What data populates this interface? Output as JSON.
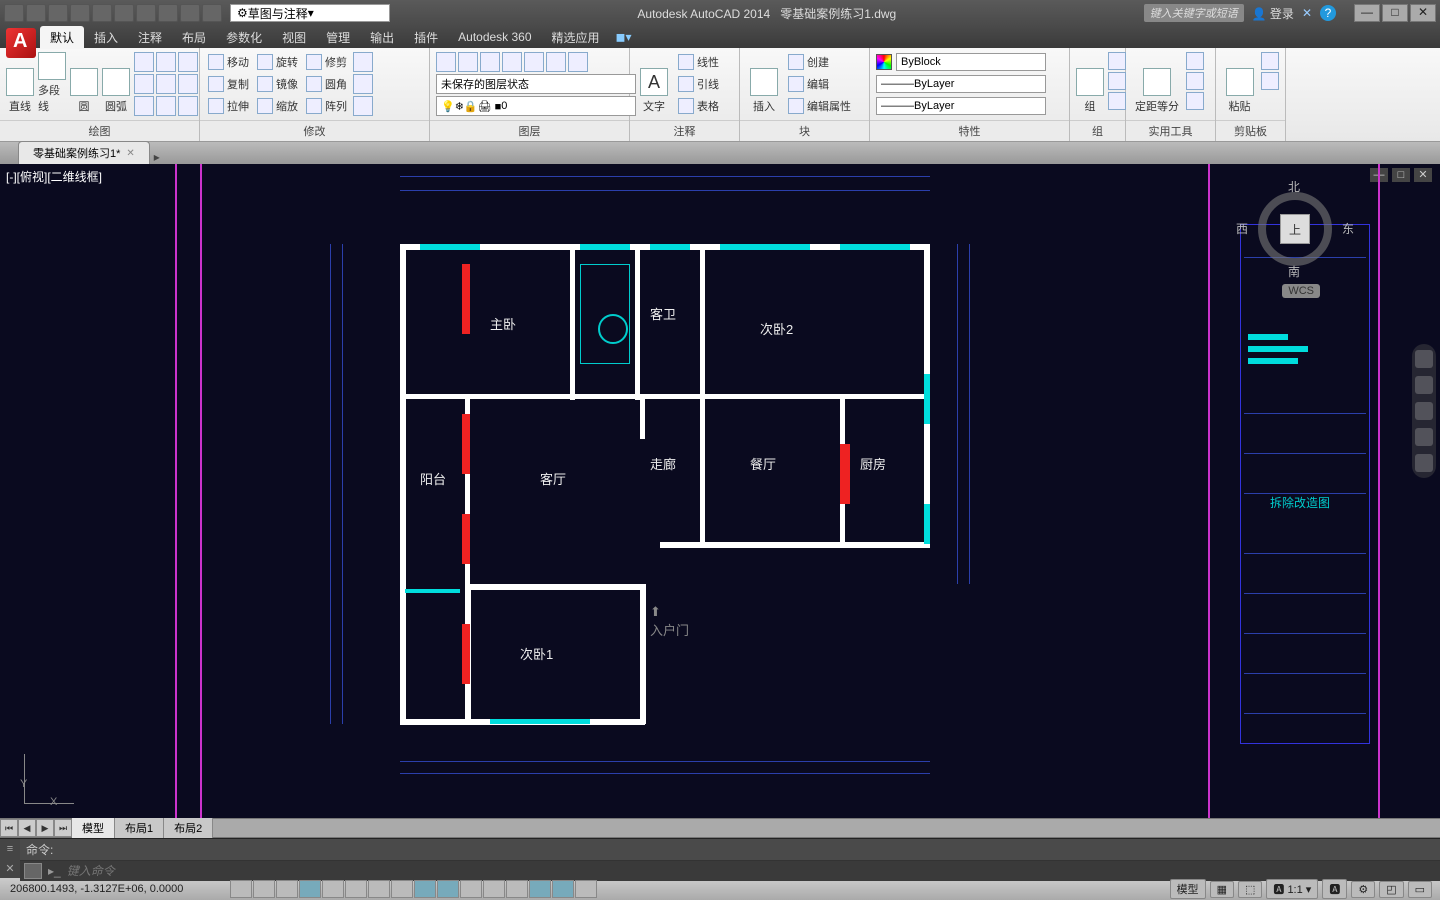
{
  "title": {
    "app": "Autodesk AutoCAD 2014",
    "file": "零基础案例练习1.dwg"
  },
  "qat_count": 10,
  "workspace": "草图与注释",
  "search_placeholder": "键入关键字或短语",
  "login_label": "登录",
  "menu": {
    "tabs": [
      "默认",
      "插入",
      "注释",
      "布局",
      "参数化",
      "视图",
      "管理",
      "输出",
      "插件",
      "Autodesk 360",
      "精选应用"
    ],
    "active": 0
  },
  "ribbon": {
    "draw": {
      "title": "绘图",
      "items": [
        "直线",
        "多段线",
        "圆",
        "圆弧"
      ]
    },
    "modify": {
      "title": "修改",
      "rows": [
        [
          "移动",
          "旋转",
          "修剪"
        ],
        [
          "复制",
          "镜像",
          "圆角"
        ],
        [
          "拉伸",
          "缩放",
          "阵列"
        ]
      ]
    },
    "layers": {
      "title": "图层",
      "state": "未保存的图层状态",
      "current": "0"
    },
    "annotate": {
      "title": "注释",
      "text": "文字",
      "rows": [
        "线性",
        "引线",
        "表格"
      ]
    },
    "insert": {
      "title": "块",
      "btn": "插入",
      "rows": [
        "创建",
        "编辑",
        "编辑属性"
      ]
    },
    "props": {
      "title": "特性",
      "color": "ByBlock",
      "ltype": "ByLayer",
      "lweight": "ByLayer"
    },
    "group": {
      "title": "组",
      "btn": "组"
    },
    "util": {
      "title": "实用工具",
      "btn": "定距等分"
    },
    "clip": {
      "title": "剪贴板",
      "btn": "粘贴"
    }
  },
  "filetab": "零基础案例练习1*",
  "viewport_label": "[-][俯视][二维线框]",
  "viewcube": {
    "top": "上",
    "n": "北",
    "s": "南",
    "e": "东",
    "w": "西"
  },
  "wcs": "WCS",
  "rooms": {
    "master": "主卧",
    "bath": "客卫",
    "bed2": "次卧2",
    "balcony": "阳台",
    "living": "客厅",
    "hall": "走廊",
    "dining": "餐厅",
    "kitchen": "厨房",
    "bed1": "次卧1",
    "entry": "入户门"
  },
  "legend_label": "拆除改造图",
  "layout": {
    "tabs": [
      "模型",
      "布局1",
      "布局2"
    ],
    "active": 0
  },
  "command": {
    "label": "命令:",
    "placeholder": "键入命令"
  },
  "status": {
    "coords": "206800.1493, -1.3127E+06, 0.0000",
    "toggle_count": 16,
    "model": "模型",
    "scale": "1:1"
  },
  "ucs": {
    "x": "X",
    "y": "Y"
  }
}
